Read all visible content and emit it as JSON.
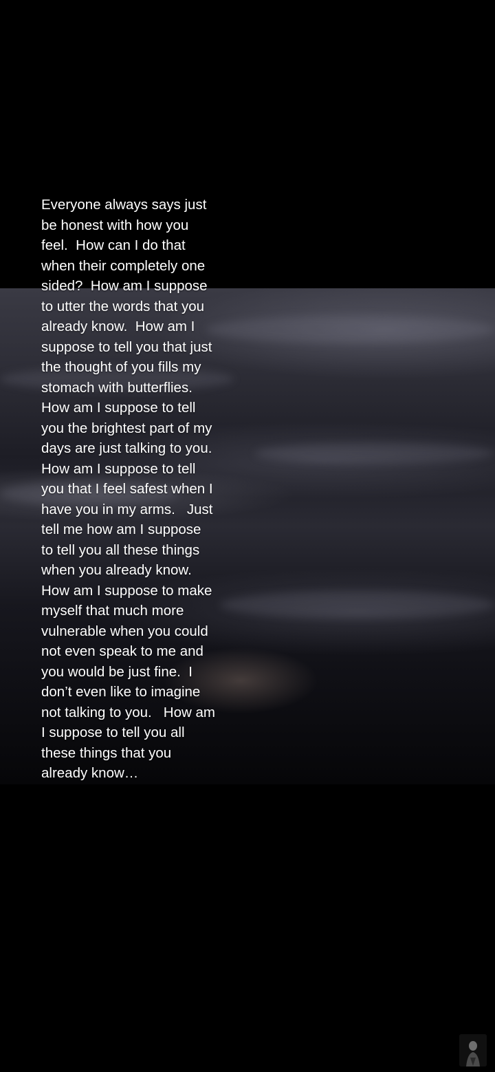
{
  "caption": {
    "lines": [
      "Everyone always says just",
      "be honest with how you",
      "feel.  How can I do that",
      "when their completely one",
      "sided?  How am I suppose",
      "to utter the words that you",
      "already know.  How am I",
      "suppose to tell you that just",
      "the thought of you fills my",
      "stomach with butterflies.",
      "How am I suppose to tell",
      "you the brightest part of my",
      "days are just talking to you.",
      "How am I suppose to tell",
      "you that I feel safest when I",
      "have you in my arms.   Just",
      "tell me how am I suppose",
      "to tell you all these things",
      "when you already know.",
      "How am I suppose to make",
      "myself that much more",
      "vulnerable when you could",
      "not even speak to me and",
      "you would be just fine.  I",
      "don’t even like to imagine",
      "not talking to you.   How am",
      "I suppose to tell you all",
      "these things that you",
      "already know…"
    ]
  },
  "background": {
    "description_icon": "night-sky-video-frame",
    "letterbox_color": "#000000"
  },
  "avatar": {
    "icon": "profile-avatar-icon"
  },
  "colors": {
    "text": "#ffffff",
    "background": "#000000"
  }
}
